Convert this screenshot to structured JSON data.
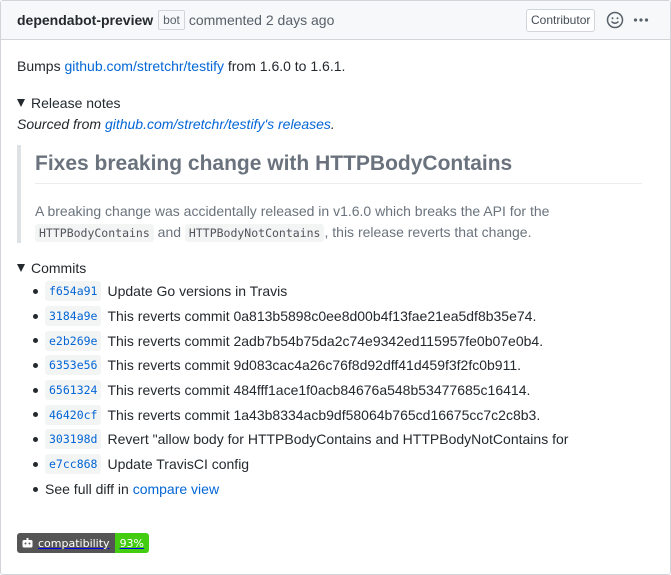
{
  "header": {
    "author": "dependabot-preview",
    "bot_label": "bot",
    "action_text": "commented 2 days ago",
    "role_label": "Contributor"
  },
  "body": {
    "bumps_prefix": "Bumps",
    "bumps_link": "github.com/stretchr/testify",
    "bumps_suffix": "from 1.6.0 to 1.6.1."
  },
  "release_notes": {
    "summary": "Release notes",
    "sourced_prefix": "Sourced from",
    "sourced_link": "github.com/stretchr/testify's releases",
    "sourced_suffix": ".",
    "heading": "Fixes breaking change with HTTPBodyContains",
    "text_1": "A breaking change was accidentally released in v1.6.0 which breaks the API for the",
    "code_1": "HTTPBodyContains",
    "text_and": "and",
    "code_2": "HTTPBodyNotContains",
    "text_2": ", this release reverts that change."
  },
  "commits": {
    "summary": "Commits",
    "items": [
      {
        "sha": "f654a91",
        "message": "Update Go versions in Travis"
      },
      {
        "sha": "3184a9e",
        "message": "This reverts commit 0a813b5898c0ee8d00b4f13fae21ea5df8b35e74."
      },
      {
        "sha": "e2b269e",
        "message": "This reverts commit 2adb7b54b75da2c74e9342ed115957fe0b07e0b4."
      },
      {
        "sha": "6353e56",
        "message": "This reverts commit 9d083cac4a26c76f8d92dff41d459f3f2fc0b911."
      },
      {
        "sha": "6561324",
        "message": "This reverts commit 484fff1ace1f0acb84676a548b53477685c16414."
      },
      {
        "sha": "46420cf",
        "message": "This reverts commit 1a43b8334acb9df58064b765cd16675cc7c2c8b3."
      },
      {
        "sha": "303198d",
        "message": "Revert \"allow body for HTTPBodyContains and HTTPBodyNotContains for"
      },
      {
        "sha": "e7cc868",
        "message": "Update TravisCI config"
      }
    ],
    "diff_prefix": "See full diff in",
    "diff_link": "compare view"
  },
  "badge": {
    "label": "compatibility",
    "value": "93%",
    "value_color": "#4c1",
    "icon": "dependabot-icon"
  },
  "icons": {
    "emoji": "smiley-icon",
    "more": "kebab-horizontal-icon",
    "disclosure": "triangle-down-icon"
  }
}
